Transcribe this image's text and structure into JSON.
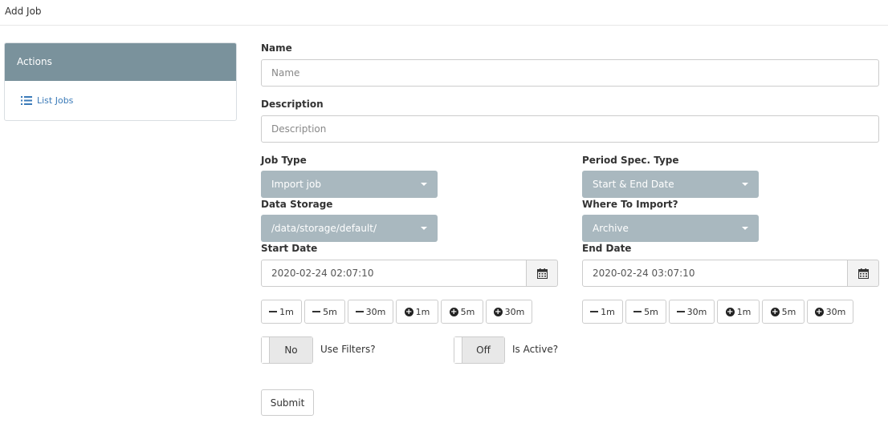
{
  "page": {
    "title": "Add Job"
  },
  "sidebar": {
    "header": "Actions",
    "links": [
      {
        "label": "List Jobs",
        "icon": "list-icon"
      }
    ]
  },
  "form": {
    "name": {
      "label": "Name",
      "placeholder": "Name",
      "value": ""
    },
    "description": {
      "label": "Description",
      "placeholder": "Description",
      "value": ""
    },
    "job_type": {
      "label": "Job Type",
      "value": "Import job"
    },
    "period_spec_type": {
      "label": "Period Spec. Type",
      "value": "Start & End Date"
    },
    "data_storage": {
      "label": "Data Storage",
      "value": "/data/storage/default/"
    },
    "where_to_import": {
      "label": "Where To Import?",
      "value": "Archive"
    },
    "start_date": {
      "label": "Start Date",
      "value": "2020-02-24 02:07:10"
    },
    "end_date": {
      "label": "End Date",
      "value": "2020-02-24 03:07:10"
    },
    "steps": {
      "minus_1m": "1m",
      "minus_5m": "5m",
      "minus_30m": "30m",
      "plus_1m": "1m",
      "plus_5m": "5m",
      "plus_30m": "30m"
    },
    "use_filters": {
      "state": "No",
      "label": "Use Filters?"
    },
    "is_active": {
      "state": "Off",
      "label": "Is Active?"
    },
    "submit_label": "Submit"
  },
  "colors": {
    "panel_header": "#7a929c",
    "select_bg": "#a9b8bf",
    "link": "#3a7ab8",
    "toggle_bg": "#e8e8e8"
  }
}
